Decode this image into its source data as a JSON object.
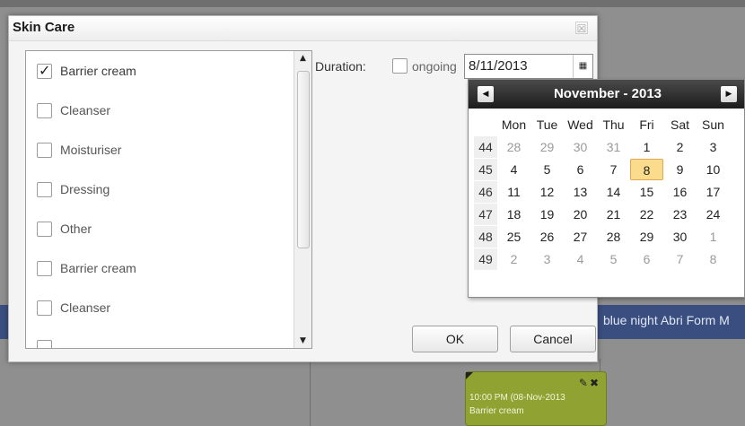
{
  "background": {
    "band_text": "blue night Abri Form M",
    "card": {
      "line1": "10:00 PM (08-Nov-2013",
      "line2": "Barrier cream",
      "edit_icon": "edit-icon",
      "delete_icon": "close-icon"
    }
  },
  "dialog": {
    "title": "Skin Care",
    "close_glyph": "☒",
    "items": [
      {
        "label": "Barrier cream",
        "checked": true
      },
      {
        "label": "Cleanser",
        "checked": false
      },
      {
        "label": "Moisturiser",
        "checked": false
      },
      {
        "label": "Dressing",
        "checked": false
      },
      {
        "label": "Other",
        "checked": false
      },
      {
        "label": "Barrier cream",
        "checked": false
      },
      {
        "label": "Cleanser",
        "checked": false
      },
      {
        "label": "",
        "checked": false
      }
    ],
    "duration_label": "Duration:",
    "ongoing_label": "ongoing",
    "date_value": "8/11/2013",
    "ok_label": "OK",
    "cancel_label": "Cancel"
  },
  "calendar": {
    "title": "November - 2013",
    "prev": "◀",
    "next": "▶",
    "weekdays": [
      "Mon",
      "Tue",
      "Wed",
      "Thu",
      "Fri",
      "Sat",
      "Sun"
    ],
    "weeks": [
      {
        "wk": "44",
        "days": [
          {
            "d": "28",
            "o": true
          },
          {
            "d": "29",
            "o": true
          },
          {
            "d": "30",
            "o": true
          },
          {
            "d": "31",
            "o": true
          },
          {
            "d": "1"
          },
          {
            "d": "2"
          },
          {
            "d": "3"
          }
        ]
      },
      {
        "wk": "45",
        "days": [
          {
            "d": "4"
          },
          {
            "d": "5"
          },
          {
            "d": "6"
          },
          {
            "d": "7"
          },
          {
            "d": "8",
            "sel": true
          },
          {
            "d": "9"
          },
          {
            "d": "10"
          }
        ]
      },
      {
        "wk": "46",
        "days": [
          {
            "d": "11"
          },
          {
            "d": "12"
          },
          {
            "d": "13"
          },
          {
            "d": "14"
          },
          {
            "d": "15"
          },
          {
            "d": "16"
          },
          {
            "d": "17"
          }
        ]
      },
      {
        "wk": "47",
        "days": [
          {
            "d": "18"
          },
          {
            "d": "19"
          },
          {
            "d": "20"
          },
          {
            "d": "21"
          },
          {
            "d": "22"
          },
          {
            "d": "23"
          },
          {
            "d": "24"
          }
        ]
      },
      {
        "wk": "48",
        "days": [
          {
            "d": "25"
          },
          {
            "d": "26"
          },
          {
            "d": "27"
          },
          {
            "d": "28"
          },
          {
            "d": "29"
          },
          {
            "d": "30"
          },
          {
            "d": "1",
            "o": true
          }
        ]
      },
      {
        "wk": "49",
        "days": [
          {
            "d": "2",
            "o": true
          },
          {
            "d": "3",
            "o": true
          },
          {
            "d": "4",
            "o": true
          },
          {
            "d": "5",
            "o": true
          },
          {
            "d": "6",
            "o": true
          },
          {
            "d": "7",
            "o": true
          },
          {
            "d": "8",
            "o": true
          }
        ]
      }
    ]
  }
}
